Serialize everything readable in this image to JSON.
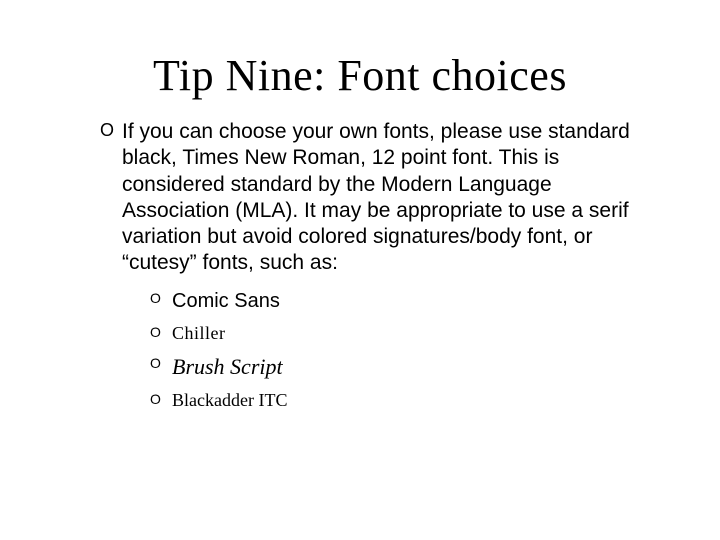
{
  "title": "Tip Nine: Font choices",
  "body": {
    "paragraph": "If you can choose your own fonts, please use standard black, Times New Roman, 12 point font. This is considered standard by the Modern Language Association (MLA). It may be appropriate to use a serif variation but avoid colored signatures/body font, or “cutesy” fonts, such as:",
    "fonts": {
      "comic_sans": "Comic Sans",
      "chiller": "Chiller",
      "brush_script": "Brush Script",
      "blackadder": "Blackadder ITC"
    }
  }
}
